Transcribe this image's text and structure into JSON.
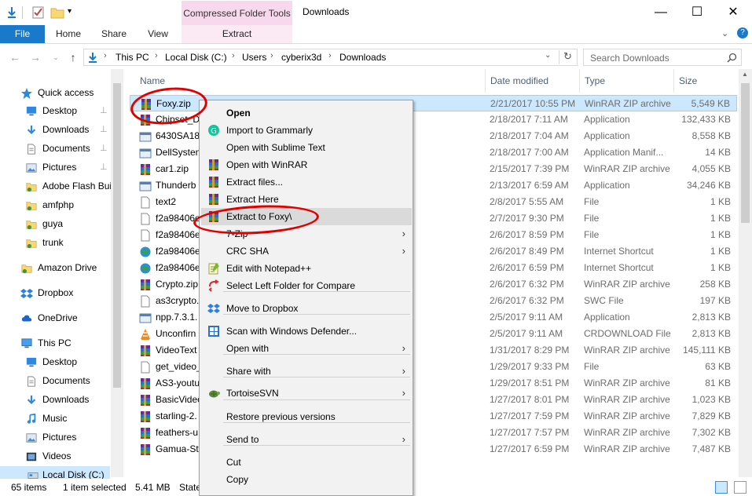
{
  "window": {
    "title": "Downloads",
    "contextual_tab_header": "Compressed Folder Tools",
    "minimize": "—",
    "maximize": "☐",
    "close": "✕"
  },
  "ribbon": {
    "tabs": [
      "File",
      "Home",
      "Share",
      "View",
      "Extract"
    ]
  },
  "address": {
    "crumbs": [
      "This PC",
      "Local Disk (C:)",
      "Users",
      "cyberix3d",
      "Downloads"
    ]
  },
  "search": {
    "placeholder": "Search Downloads"
  },
  "nav": {
    "items": [
      {
        "label": "Quick access",
        "icon": "star-icon"
      },
      {
        "label": "Desktop",
        "icon": "desktop-icon",
        "pinned": true
      },
      {
        "label": "Downloads",
        "icon": "download-icon",
        "pinned": true
      },
      {
        "label": "Documents",
        "icon": "documents-icon",
        "pinned": true
      },
      {
        "label": "Pictures",
        "icon": "pictures-icon",
        "pinned": true
      },
      {
        "label": "Adobe Flash Bui",
        "icon": "folder-icon"
      },
      {
        "label": "amfphp",
        "icon": "folder-icon"
      },
      {
        "label": "guya",
        "icon": "folder-icon"
      },
      {
        "label": "trunk",
        "icon": "folder-icon"
      },
      {
        "label": "Amazon Drive",
        "icon": "folder-icon"
      },
      {
        "label": "Dropbox",
        "icon": "dropbox-icon"
      },
      {
        "label": "OneDrive",
        "icon": "cloud-icon"
      },
      {
        "label": "This PC",
        "icon": "computer-icon"
      },
      {
        "label": "Desktop",
        "icon": "desktop-icon"
      },
      {
        "label": "Documents",
        "icon": "documents-icon"
      },
      {
        "label": "Downloads",
        "icon": "download-icon"
      },
      {
        "label": "Music",
        "icon": "music-icon"
      },
      {
        "label": "Pictures",
        "icon": "pictures-icon"
      },
      {
        "label": "Videos",
        "icon": "videos-icon"
      },
      {
        "label": "Local Disk (C:)",
        "icon": "drive-icon"
      }
    ]
  },
  "columns": {
    "name": "Name",
    "date": "Date modified",
    "type": "Type",
    "size": "Size"
  },
  "files": [
    {
      "name": "Foxy.zip",
      "date": "2/21/2017 10:55 PM",
      "type": "WinRAR ZIP archive",
      "size": "5,549 KB",
      "icon": "winrar-icon"
    },
    {
      "name": "Chipset_D",
      "date": "2/18/2017 7:11 AM",
      "type": "Application",
      "size": "132,433 KB",
      "icon": "winrar-icon"
    },
    {
      "name": "6430SA18.",
      "date": "2/18/2017 7:04 AM",
      "type": "Application",
      "size": "8,558 KB",
      "icon": "app-icon"
    },
    {
      "name": "DellSysten",
      "date": "2/18/2017 7:00 AM",
      "type": "Application Manif...",
      "size": "14 KB",
      "icon": "app-icon"
    },
    {
      "name": "car1.zip",
      "date": "2/15/2017 7:39 PM",
      "type": "WinRAR ZIP archive",
      "size": "4,055 KB",
      "icon": "winrar-icon"
    },
    {
      "name": "Thunderb",
      "date": "2/13/2017 6:59 AM",
      "type": "Application",
      "size": "34,246 KB",
      "icon": "app-icon"
    },
    {
      "name": "text2",
      "date": "2/8/2017 5:55 AM",
      "type": "File",
      "size": "1 KB",
      "icon": "file-icon"
    },
    {
      "name": "f2a98406e",
      "date": "2/7/2017 9:30 PM",
      "type": "File",
      "size": "1 KB",
      "icon": "file-icon"
    },
    {
      "name": "f2a98406e",
      "date": "2/6/2017 8:59 PM",
      "type": "File",
      "size": "1 KB",
      "icon": "file-icon"
    },
    {
      "name": "f2a98406e",
      "date": "2/6/2017 8:49 PM",
      "type": "Internet Shortcut",
      "size": "1 KB",
      "icon": "shortcut-icon"
    },
    {
      "name": "f2a98406e",
      "date": "2/6/2017 6:59 PM",
      "type": "Internet Shortcut",
      "size": "1 KB",
      "icon": "shortcut-icon"
    },
    {
      "name": "Crypto.zip",
      "date": "2/6/2017 6:32 PM",
      "type": "WinRAR ZIP archive",
      "size": "258 KB",
      "icon": "winrar-icon"
    },
    {
      "name": "as3crypto.",
      "date": "2/6/2017 6:32 PM",
      "type": "SWC File",
      "size": "197 KB",
      "icon": "file-icon"
    },
    {
      "name": "npp.7.3.1.",
      "date": "2/5/2017 9:11 AM",
      "type": "Application",
      "size": "2,813 KB",
      "icon": "app-icon"
    },
    {
      "name": "Unconfirn",
      "date": "2/5/2017 9:11 AM",
      "type": "CRDOWNLOAD File",
      "size": "2,813 KB",
      "icon": "vlc-icon"
    },
    {
      "name": "VideoText",
      "date": "1/31/2017 8:29 PM",
      "type": "WinRAR ZIP archive",
      "size": "145,111 KB",
      "icon": "winrar-icon"
    },
    {
      "name": "get_video_",
      "date": "1/29/2017 9:33 PM",
      "type": "File",
      "size": "63 KB",
      "icon": "file-icon"
    },
    {
      "name": "AS3-youtu",
      "date": "1/29/2017 8:51 PM",
      "type": "WinRAR ZIP archive",
      "size": "81 KB",
      "icon": "winrar-icon"
    },
    {
      "name": "BasicVideo",
      "date": "1/27/2017 8:01 PM",
      "type": "WinRAR ZIP archive",
      "size": "1,023 KB",
      "icon": "winrar-icon"
    },
    {
      "name": "starling-2.",
      "date": "1/27/2017 7:59 PM",
      "type": "WinRAR ZIP archive",
      "size": "7,829 KB",
      "icon": "winrar-icon"
    },
    {
      "name": "feathers-u",
      "date": "1/27/2017 7:57 PM",
      "type": "WinRAR ZIP archive",
      "size": "7,302 KB",
      "icon": "winrar-icon"
    },
    {
      "name": "Gamua-St",
      "date": "1/27/2017 6:59 PM",
      "type": "WinRAR ZIP archive",
      "size": "7,487 KB",
      "icon": "winrar-icon"
    }
  ],
  "status": {
    "count": "65 items",
    "selected": "1 item selected",
    "size": "5.41 MB",
    "state": "State"
  },
  "context_menu": {
    "items": [
      {
        "label": "Open",
        "bold": true,
        "icon": ""
      },
      {
        "label": "Import to Grammarly",
        "icon": "grammarly-icon"
      },
      {
        "label": "Open with Sublime Text",
        "icon": ""
      },
      {
        "label": "Open with WinRAR",
        "icon": "winrar-icon"
      },
      {
        "label": "Extract files...",
        "icon": "winrar-icon"
      },
      {
        "label": "Extract Here",
        "icon": "winrar-icon"
      },
      {
        "label": "Extract to Foxy\\",
        "icon": "winrar-icon",
        "highlighted": true
      },
      {
        "label": "7-Zip",
        "icon": "",
        "submenu": true
      },
      {
        "label": "CRC SHA",
        "icon": "",
        "submenu": true
      },
      {
        "label": "Edit with Notepad++",
        "icon": "notepadpp-icon"
      },
      {
        "label": "Select Left Folder for Compare",
        "icon": "compare-icon"
      },
      {
        "label": "Move to Dropbox",
        "icon": "dropbox-icon"
      },
      {
        "label": "Scan with Windows Defender...",
        "icon": "defender-icon"
      },
      {
        "label": "Open with",
        "icon": "",
        "submenu": true
      },
      {
        "label": "Share with",
        "icon": "",
        "submenu": true
      },
      {
        "label": "TortoiseSVN",
        "icon": "tortoise-icon",
        "submenu": true
      },
      {
        "label": "Restore previous versions",
        "icon": ""
      },
      {
        "label": "Send to",
        "icon": "",
        "submenu": true
      },
      {
        "label": "Cut",
        "icon": ""
      },
      {
        "label": "Copy",
        "icon": ""
      }
    ]
  },
  "colors": {
    "accent": "#1979ca",
    "selection": "#cce8ff",
    "annotation": "#e00000",
    "contextual_tab": "#f8d8ec"
  }
}
